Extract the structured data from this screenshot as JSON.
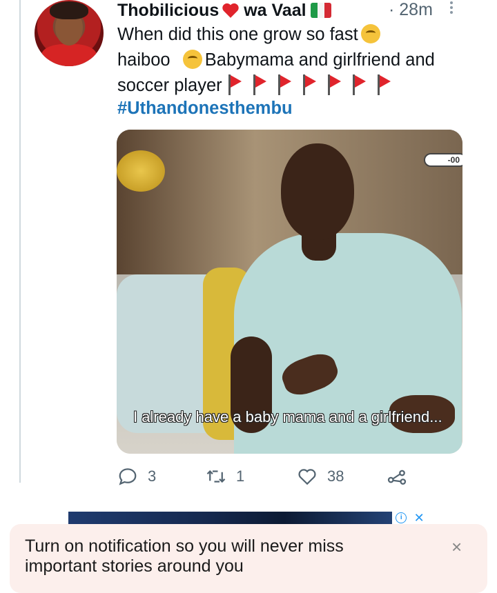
{
  "author": {
    "name_first": "Thobilicious",
    "name_last": "wa Vaal",
    "time": "· 28m"
  },
  "tweet": {
    "line1": "When did this one grow so fast",
    "line2_a": "haiboo",
    "line2_b": "Babymama and girlfriend and",
    "line3": "soccer player",
    "red_flag_count": 7,
    "hashtag": "#Uthandonesthembu"
  },
  "media": {
    "caption": "I already have a baby mama and a girlfriend...",
    "badge": "-00"
  },
  "actions": {
    "replies": "3",
    "retweets": "1",
    "likes": "38"
  },
  "ad": {
    "info": "i",
    "close": "✕"
  },
  "notification": {
    "text": "Turn on notification so you will never miss important stories around you",
    "close": "×"
  },
  "colors": {
    "hashtag": "#1d74b8",
    "muted": "#536471",
    "notif_bg": "#fcefec"
  }
}
